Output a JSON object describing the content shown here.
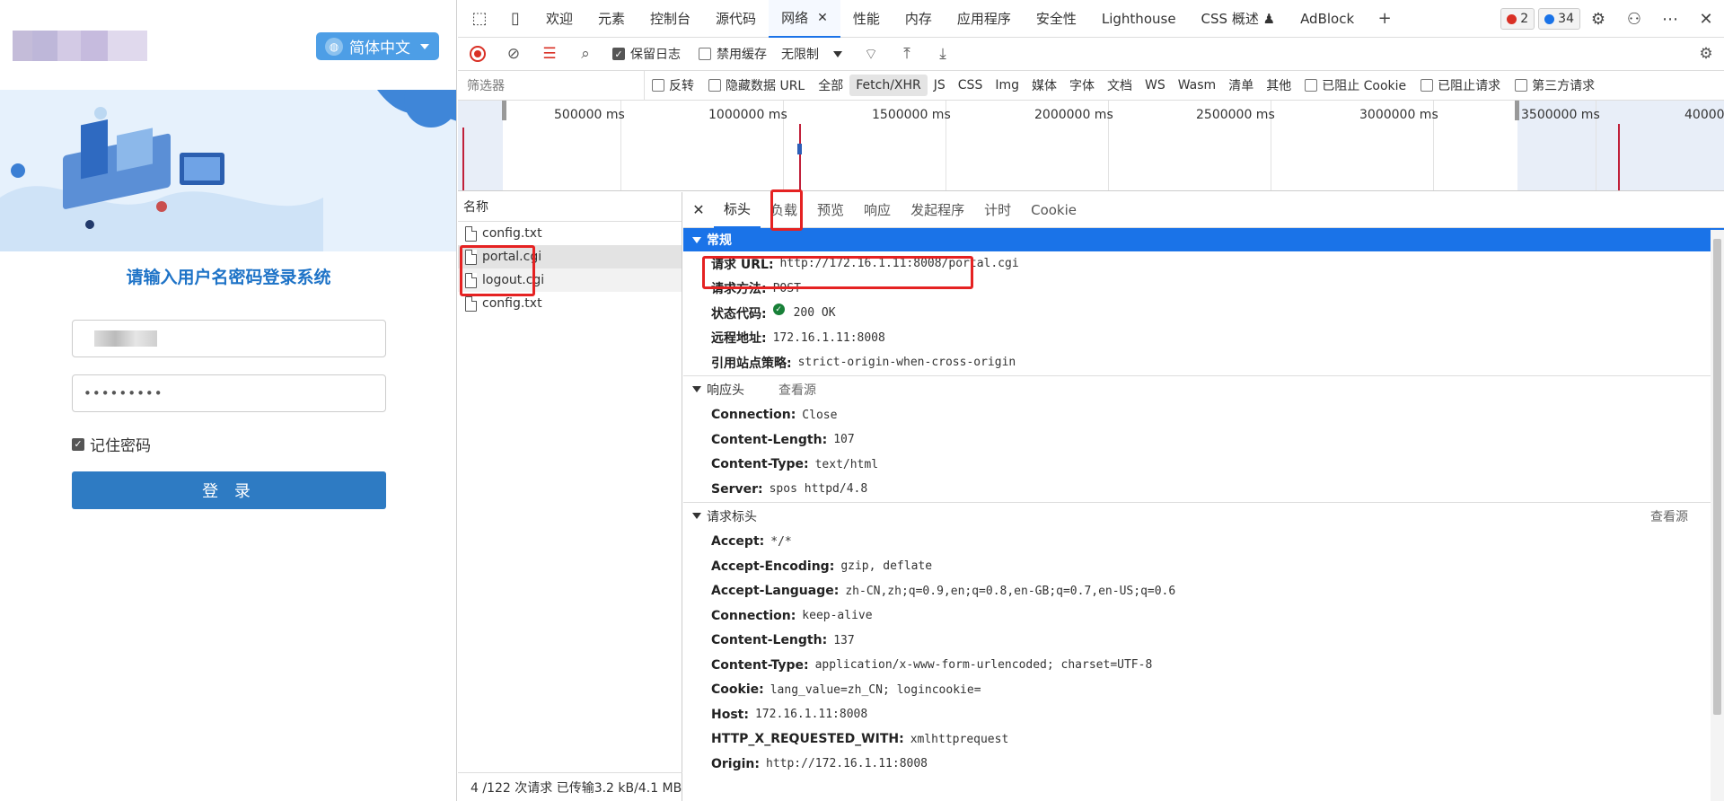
{
  "login": {
    "lang_label": "简体中文",
    "title": "请输入用户名密码登录系统",
    "password_value": "•••••••••",
    "remember_label": "记住密码",
    "login_button": "登 录"
  },
  "devtools": {
    "tabs": [
      {
        "label": "欢迎"
      },
      {
        "label": "元素"
      },
      {
        "label": "控制台"
      },
      {
        "label": "源代码"
      },
      {
        "label": "网络",
        "active": true
      },
      {
        "label": "性能"
      },
      {
        "label": "内存"
      },
      {
        "label": "应用程序"
      },
      {
        "label": "安全性"
      },
      {
        "label": "Lighthouse"
      },
      {
        "label": "CSS 概述 ♟"
      },
      {
        "label": "AdBlock"
      }
    ],
    "errors_count": "2",
    "messages_count": "34",
    "toolbar": {
      "preserve_log": "保留日志",
      "disable_cache": "禁用缓存",
      "throttling": "无限制"
    },
    "filter": {
      "placeholder": "筛选器",
      "invert": "反转",
      "hide_data_urls": "隐藏数据 URL",
      "types": [
        "全部",
        "Fetch/XHR",
        "JS",
        "CSS",
        "Img",
        "媒体",
        "字体",
        "文档",
        "WS",
        "Wasm",
        "清单",
        "其他"
      ],
      "selected_type": "Fetch/XHR",
      "blocked_cookies": "已阻止 Cookie",
      "blocked_requests": "已阻止请求",
      "third_party": "第三方请求"
    },
    "timeline_ticks": [
      "500000 ms",
      "1000000 ms",
      "1500000 ms",
      "2000000 ms",
      "2500000 ms",
      "3000000 ms",
      "3500000 ms",
      "40000"
    ],
    "requests_header": "名称",
    "requests": [
      "config.txt",
      "portal.cgi",
      "logout.cgi",
      "config.txt"
    ],
    "status": "4 /122 次请求  已传输3.2 kB/4.1 MB",
    "detail_tabs": [
      "标头",
      "负载",
      "预览",
      "响应",
      "发起程序",
      "计时",
      "Cookie"
    ],
    "general": {
      "title": "常规",
      "rows": [
        {
          "k": "请求 URL:",
          "v": "http://172.16.1.11:8008/portal.cgi"
        },
        {
          "k": "请求方法:",
          "v": "POST"
        },
        {
          "k": "状态代码:",
          "v": "200 OK"
        },
        {
          "k": "远程地址:",
          "v": "172.16.1.11:8008"
        },
        {
          "k": "引用站点策略:",
          "v": "strict-origin-when-cross-origin"
        }
      ]
    },
    "response_headers": {
      "title": "响应头",
      "view_source": "查看源",
      "rows": [
        {
          "k": "Connection:",
          "v": "Close"
        },
        {
          "k": "Content-Length:",
          "v": "107"
        },
        {
          "k": "Content-Type:",
          "v": "text/html"
        },
        {
          "k": "Server:",
          "v": "spos httpd/4.8"
        }
      ]
    },
    "request_headers": {
      "title": "请求标头",
      "view_source": "查看源",
      "rows": [
        {
          "k": "Accept:",
          "v": "*/*"
        },
        {
          "k": "Accept-Encoding:",
          "v": "gzip, deflate"
        },
        {
          "k": "Accept-Language:",
          "v": "zh-CN,zh;q=0.9,en;q=0.8,en-GB;q=0.7,en-US;q=0.6"
        },
        {
          "k": "Connection:",
          "v": "keep-alive"
        },
        {
          "k": "Content-Length:",
          "v": "137"
        },
        {
          "k": "Content-Type:",
          "v": "application/x-www-form-urlencoded; charset=UTF-8"
        },
        {
          "k": "Cookie:",
          "v": "lang_value=zh_CN; logincookie="
        },
        {
          "k": "Host:",
          "v": "172.16.1.11:8008"
        },
        {
          "k": "HTTP_X_REQUESTED_WITH:",
          "v": "xmlhttprequest"
        },
        {
          "k": "Origin:",
          "v": "http://172.16.1.11:8008"
        }
      ]
    }
  },
  "colors": {
    "accent": "#1a73e8",
    "highlight": "#e52222",
    "login_button": "#2e7bc3",
    "title": "#1e73c7"
  }
}
